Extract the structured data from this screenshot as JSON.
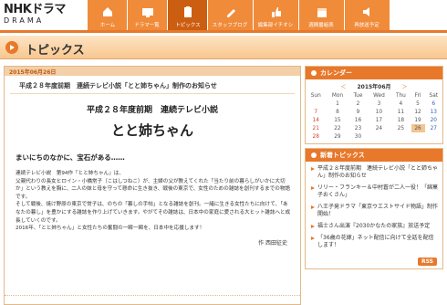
{
  "logo": {
    "main": "NHKドラマ",
    "sub": "DRAMA"
  },
  "nav": [
    {
      "label": "ホーム"
    },
    {
      "label": "ドラマ一覧"
    },
    {
      "label": "トピックス"
    },
    {
      "label": "スタッフブログ"
    },
    {
      "label": "編集部イチオシ"
    },
    {
      "label": "週間番組表"
    },
    {
      "label": "再放送予定"
    }
  ],
  "page_title": "トピックス",
  "article": {
    "date": "2015年06月26日",
    "title": "平成２８年度前期　連続テレビ小説「とと姉ちゃん」制作のお知らせ",
    "lead1": "平成２８年度前期　連続テレビ小説",
    "lead2": "とと姉ちゃん",
    "subhead": "まいにちのなかに、宝石がある……",
    "para1": "連続テレビ小説　第94作「とと姉ちゃん」は、",
    "para2": "父親代わりの長女ヒロイン・小橋常子（こはしつねこ）が、主婦の父が教えてくれた「当たり前の暮らしがいかに大切か」という教えを胸に、二人の妹と母を守って懸命に生き抜き、戦後の東京で、女性のための雑誌を創刊するまでの物語です。",
    "para3": "そして戦後、焼け野原の東京で常子は、のちの「暮しの手帖」となる雑誌を創刊。一緒に生きる女性たちに向けて、「あなたの暮し」を豊かにする雑誌を作り上げていきます。やがてその雑誌は、日本中の家庭に愛される大ヒット雑誌へと成長していくのです。",
    "para4": "2016年、「とと姉ちゃん」と女性たちの奮闘の一瞬一瞬を、日本中を応援します！",
    "author": "作 西田征史"
  },
  "calendar": {
    "heading": "カレンダー",
    "prev": "＜",
    "month": "2015年06月",
    "next": "＞",
    "weekdays": [
      "Sun",
      "Mon",
      "Tue",
      "Wed",
      "Thu",
      "Fri",
      "Sat"
    ],
    "weeks": [
      [
        "",
        "1",
        "2",
        "3",
        "4",
        "5",
        "6"
      ],
      [
        "7",
        "8",
        "9",
        "10",
        "11",
        "12",
        "13"
      ],
      [
        "14",
        "15",
        "16",
        "17",
        "18",
        "19",
        "20"
      ],
      [
        "21",
        "22",
        "23",
        "24",
        "25",
        "26",
        "27"
      ],
      [
        "28",
        "29",
        "30",
        "",
        "",
        "",
        ""
      ]
    ]
  },
  "recent": {
    "heading": "新着トピックス",
    "items": [
      {
        "text": "平成２８年度前期　連続テレビ小説「とと姉ちゃん」制作のお知らせ"
      },
      {
        "text": "リリー・フランキー＆中村蒼が二人一役！「綿菓子おくさん」"
      },
      {
        "text": "八王子発ドラマ「東京ウエストサイド物語」制作開始！"
      },
      {
        "text": "福士さん出演『2030かなたの家族』放送予定"
      },
      {
        "text": "「36歳の花嫁」ネット配信に向けて全話を配信します！"
      }
    ],
    "rss": "RSS"
  },
  "colors": {
    "accent": "#e8782a",
    "nav_active": "#cc5e12"
  }
}
